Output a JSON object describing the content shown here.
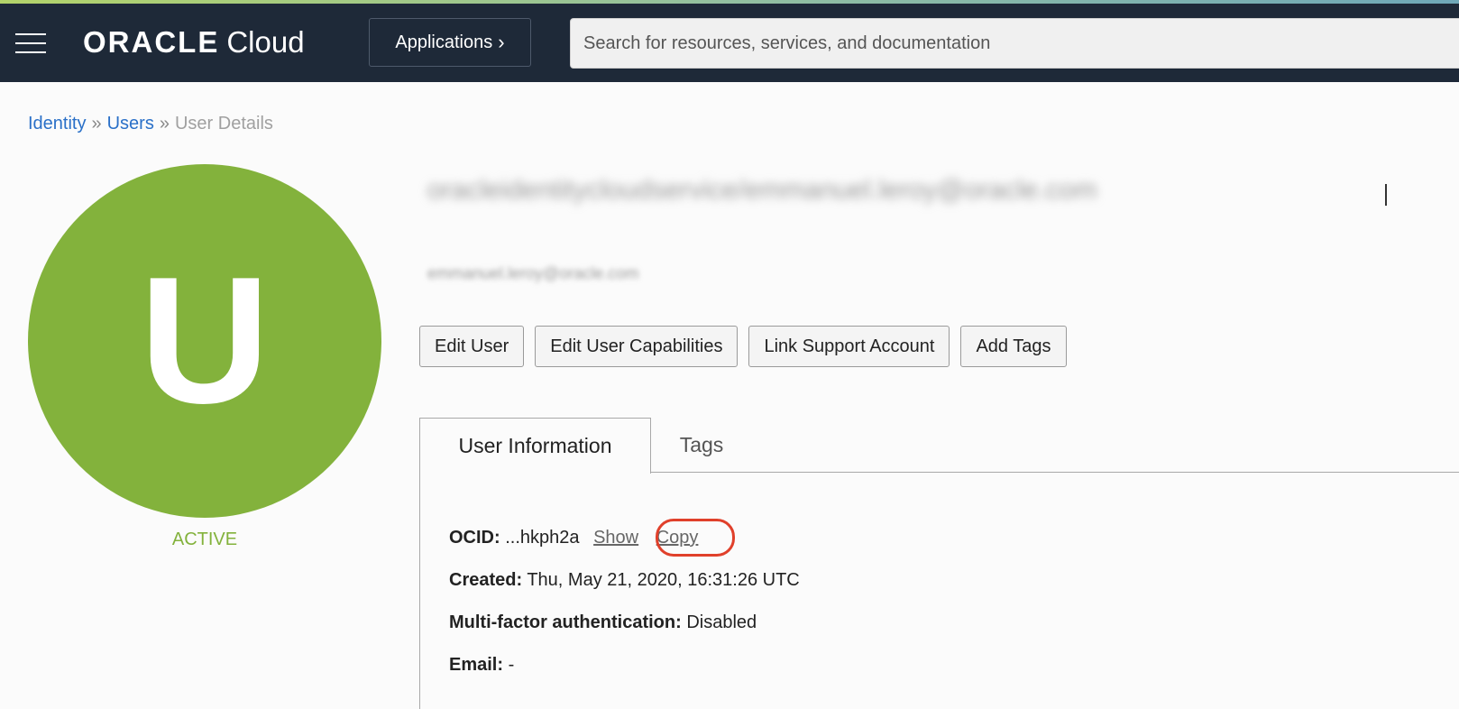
{
  "topbar": {
    "brand": "ORACLE",
    "product": "Cloud",
    "applications_label": "Applications",
    "search_placeholder": "Search for resources, services, and documentation"
  },
  "breadcrumb": {
    "items": [
      "Identity",
      "Users"
    ],
    "current": "User Details",
    "separator": "»"
  },
  "user": {
    "avatar_letter": "U",
    "status": "ACTIVE",
    "name_blurred": "oracleidentitycloudservice/emmanuel.leroy@oracle.com",
    "email_blurred": "emmanuel.leroy@oracle.com"
  },
  "actions": {
    "edit_user": "Edit User",
    "edit_capabilities": "Edit User Capabilities",
    "link_support": "Link Support Account",
    "add_tags": "Add Tags"
  },
  "tabs": {
    "user_information": "User Information",
    "tags": "Tags"
  },
  "details": {
    "ocid_label": "OCID:",
    "ocid_value": "...hkph2a",
    "show_label": "Show",
    "copy_label": "Copy",
    "created_label": "Created:",
    "created_value": "Thu, May 21, 2020, 16:31:26 UTC",
    "mfa_label": "Multi-factor authentication:",
    "mfa_value": "Disabled",
    "email_label": "Email:",
    "email_value": "-"
  },
  "colors": {
    "topbar": "#1e2938",
    "avatar": "#83b23c",
    "link": "#2a70c8",
    "highlight": "#e0402b"
  }
}
